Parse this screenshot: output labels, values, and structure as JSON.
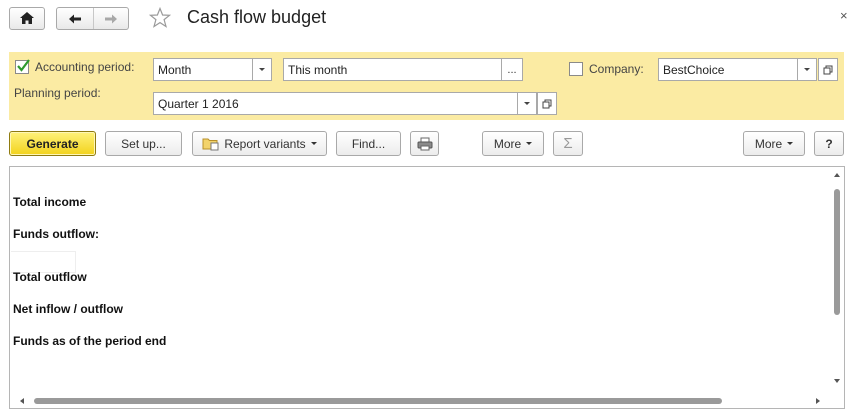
{
  "window": {
    "title": "Cash flow budget",
    "close_glyph": "×"
  },
  "params": {
    "accounting_period_label": "Accounting period:",
    "accounting_period_checked": true,
    "period_type": "Month",
    "period_value": "This month",
    "period_dots": "...",
    "company_label": "Company:",
    "company_checked": false,
    "company_value": "BestChoice",
    "planning_period_label": "Planning period:",
    "planning_period_value": "Quarter 1 2016"
  },
  "toolbar": {
    "generate": "Generate",
    "setup": "Set up...",
    "report_variants": "Report variants",
    "find": "Find...",
    "more_left": "More",
    "sum_glyph": "Σ",
    "more_right": "More",
    "help": "?"
  },
  "report": {
    "rows": [
      "Total income",
      "Funds outflow:",
      "Total outflow",
      "Net inflow / outflow",
      "Funds as of the period end"
    ]
  },
  "colors": {
    "panel_bg": "#fbeba3",
    "generate_bg": "#f2d21c",
    "checkmark": "#2e9a2e"
  }
}
